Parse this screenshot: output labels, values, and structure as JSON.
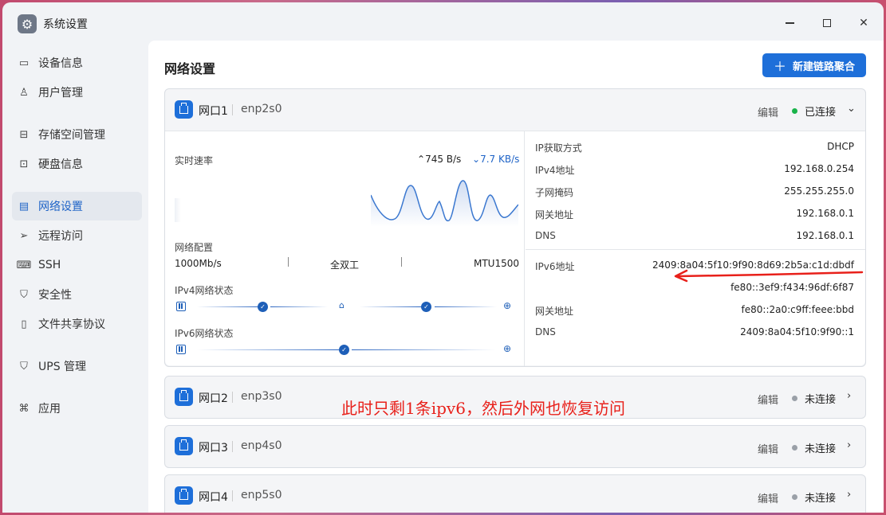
{
  "window": {
    "title": "系统设置",
    "icon": "gear-icon"
  },
  "sidebar": {
    "items": [
      {
        "label": "设备信息",
        "icon": "device-info-icon",
        "glyph": "▭"
      },
      {
        "label": "用户管理",
        "icon": "user-icon",
        "glyph": "♙"
      },
      {
        "label": "存储空间管理",
        "icon": "storage-icon",
        "glyph": "⊟"
      },
      {
        "label": "硬盘信息",
        "icon": "disk-icon",
        "glyph": "⊡"
      },
      {
        "label": "网络设置",
        "icon": "network-icon",
        "glyph": "▤"
      },
      {
        "label": "远程访问",
        "icon": "remote-access-icon",
        "glyph": "➢"
      },
      {
        "label": "SSH",
        "icon": "ssh-icon",
        "glyph": "⌨"
      },
      {
        "label": "安全性",
        "icon": "shield-icon",
        "glyph": "⛉"
      },
      {
        "label": "文件共享协议",
        "icon": "file-share-icon",
        "glyph": "▯"
      },
      {
        "label": "UPS 管理",
        "icon": "ups-icon",
        "glyph": "⛉"
      },
      {
        "label": "应用",
        "icon": "apps-icon",
        "glyph": "⌘"
      }
    ],
    "active_index": 4
  },
  "main": {
    "title": "网络设置",
    "new_aggregation_button": "新建链路聚合",
    "plus_glyph": "＋"
  },
  "ports": [
    {
      "name": "网口1",
      "device": "enp2s0",
      "edit_label": "编辑",
      "status": "已连接",
      "status_color": "#19b34a",
      "expanded": true,
      "chevron": "⌄",
      "realtime": {
        "label": "实时速率",
        "up_prefix": "⌃",
        "up": "745 B/s",
        "down_prefix": "⌄",
        "down": "7.7 KB/s"
      },
      "config": {
        "label": "网络配置",
        "speed": "1000Mb/s",
        "duplex": "全双工",
        "mtu": "MTU1500"
      },
      "ipv4_status_label": "IPv4网络状态",
      "ipv6_status_label": "IPv6网络状态",
      "ipv4": [
        {
          "key": "IP获取方式",
          "value": "DHCP"
        },
        {
          "key": "IPv4地址",
          "value": "192.168.0.254"
        },
        {
          "key": "子网掩码",
          "value": "255.255.255.0"
        },
        {
          "key": "网关地址",
          "value": "192.168.0.1"
        },
        {
          "key": "DNS",
          "value": "192.168.0.1"
        }
      ],
      "ipv6": {
        "address_label": "IPv6地址",
        "addresses": [
          "2409:8a04:5f10:9f90:8d69:2b5a:c1d:dbdf",
          "fe80::3ef9:f434:96df:6f87"
        ],
        "gateway_label": "网关地址",
        "gateway": "fe80::2a0:c9ff:feee:bbd",
        "dns_label": "DNS",
        "dns": "2409:8a04:5f10:9f90::1"
      }
    },
    {
      "name": "网口2",
      "device": "enp3s0",
      "edit_label": "编辑",
      "status": "未连接",
      "status_color": "#9aa0a8",
      "chevron": "›"
    },
    {
      "name": "网口3",
      "device": "enp4s0",
      "edit_label": "编辑",
      "status": "未连接",
      "status_color": "#9aa0a8",
      "chevron": "›"
    },
    {
      "name": "网口4",
      "device": "enp5s0",
      "edit_label": "编辑",
      "status": "未连接",
      "status_color": "#9aa0a8",
      "chevron": "›"
    }
  ],
  "annotation": {
    "text": "此时只剩1条ipv6，然后外网也恢复访问",
    "color": "#e8201a"
  },
  "colors": {
    "accent": "#1e6fd9",
    "active_nav": "#1e63c7"
  }
}
